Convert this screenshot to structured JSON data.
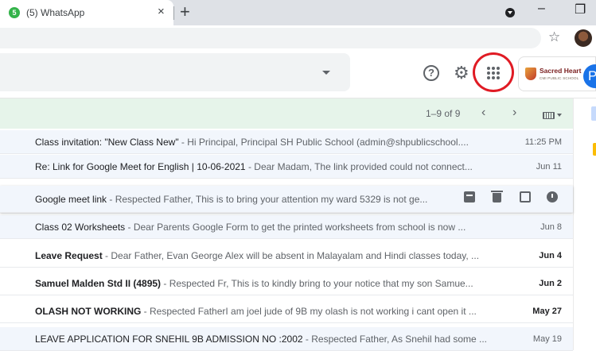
{
  "browser": {
    "tab_title": "(5) WhatsApp",
    "tab_badge": "5",
    "new_tab_label": "+",
    "close_tab_label": "×",
    "minimize_label": "–",
    "restore_label": "❐"
  },
  "header": {
    "help_label": "?",
    "school_name": "Sacred Heart",
    "school_sub": "CMI PUBLIC SCHOOL",
    "avatar_letter": "P",
    "accent_color": "#1a73e8",
    "highlight_color": "#e01b24"
  },
  "toolbar": {
    "pager_text": "1–9 of 9",
    "prev_label": "‹",
    "next_label": "›"
  },
  "emails": [
    {
      "subject": "Class invitation: \"New Class New\"",
      "snippet": " - Hi Principal, Principal SH Public School (admin@shpublicschool....",
      "date": "11:25 PM",
      "unread": false
    },
    {
      "subject": "Re: Link for Google Meet for English | 10-06-2021",
      "snippet": " - Dear Madam, The link provided could not connect...",
      "date": "Jun 11",
      "unread": false
    },
    {
      "subject": "Google meet link",
      "snippet": " - Respected Father, This is to bring your attention my ward 5329 is not ge...",
      "date": "",
      "unread": false
    },
    {
      "subject": "Class 02 Worksheets",
      "snippet": " - Dear Parents Google Form to get the printed worksheets from school is now ...",
      "date": "Jun 8",
      "unread": false
    },
    {
      "subject": "Leave Request",
      "snippet": " - Dear Father, Evan George Alex will be absent in Malayalam and Hindi classes today, ...",
      "date": "Jun 4",
      "unread": true
    },
    {
      "subject": "Samuel Malden Std II (4895)",
      "snippet": " - Respected Fr, This is to kindly bring to your notice that my son Samue...",
      "date": "Jun 2",
      "unread": true
    },
    {
      "subject": "OLASH NOT WORKING",
      "snippet": " - Respected FatherI am joel jude of 9B my olash is not working i cant open it ...",
      "date": "May 27",
      "unread": true
    },
    {
      "subject": "LEAVE APPLICATION FOR SNEHIL 9B ADMISSION NO :2002",
      "snippet": " - Respected Father, As Snehil had some ...",
      "date": "May 19",
      "unread": false
    }
  ]
}
